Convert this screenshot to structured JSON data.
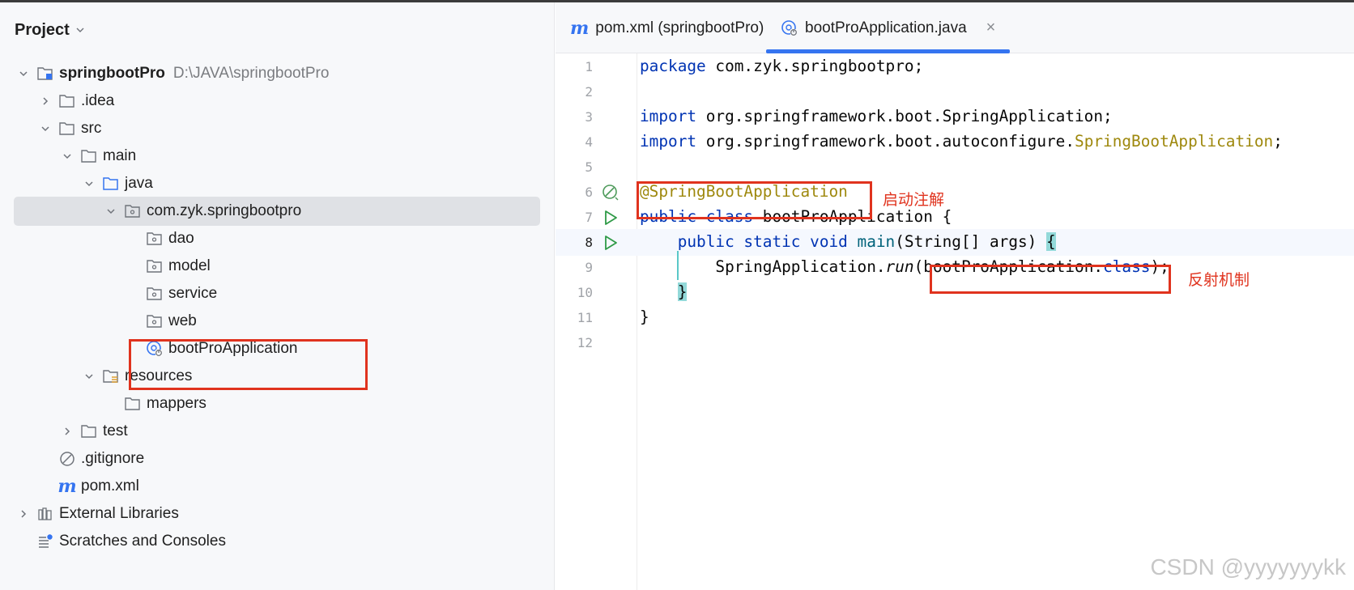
{
  "panel": {
    "title": "Project",
    "tree": [
      {
        "label": "springbootPro",
        "path": "D:\\JAVA\\springbootPro",
        "icon": "module-folder-icon",
        "expand": "down"
      },
      {
        "label": ".idea",
        "icon": "folder-icon",
        "expand": "right"
      },
      {
        "label": "src",
        "icon": "folder-icon",
        "expand": "down"
      },
      {
        "label": "main",
        "icon": "folder-icon",
        "expand": "down"
      },
      {
        "label": "java",
        "icon": "source-folder-icon",
        "expand": "down"
      },
      {
        "label": "com.zyk.springbootpro",
        "icon": "package-icon",
        "expand": "down",
        "selected": true
      },
      {
        "label": "dao",
        "icon": "package-icon"
      },
      {
        "label": "model",
        "icon": "package-icon"
      },
      {
        "label": "service",
        "icon": "package-icon"
      },
      {
        "label": "web",
        "icon": "package-icon"
      },
      {
        "label": "bootProApplication",
        "icon": "spring-boot-class-icon"
      },
      {
        "label": "resources",
        "icon": "resources-folder-icon",
        "expand": "down"
      },
      {
        "label": "mappers",
        "icon": "folder-icon"
      },
      {
        "label": "test",
        "icon": "folder-icon",
        "expand": "right"
      },
      {
        "label": ".gitignore",
        "icon": "gitignore-icon"
      },
      {
        "label": "pom.xml",
        "icon": "maven-icon"
      },
      {
        "label": "External Libraries",
        "icon": "library-icon",
        "expand": "right"
      },
      {
        "label": "Scratches and Consoles",
        "icon": "scratches-icon"
      }
    ]
  },
  "tabs": [
    {
      "label": "pom.xml (springbootPro)",
      "icon": "maven-icon",
      "active": false
    },
    {
      "label": "bootProApplication.java",
      "icon": "spring-boot-class-icon",
      "active": true,
      "close": "×"
    }
  ],
  "editor": {
    "line_numbers": [
      "1",
      "2",
      "3",
      "4",
      "5",
      "6",
      "7",
      "8",
      "9",
      "10",
      "11",
      "12"
    ],
    "current_line": 8,
    "lines": {
      "l1": {
        "kw": "package",
        "rest": " com.zyk.springbootpro;"
      },
      "l3": {
        "kw": "import",
        "rest": " org.springframework.boot.SpringApplication;"
      },
      "l4": {
        "kw": "import",
        "rest": " org.springframework.boot.autoconfigure.",
        "ann": "SpringBootApplication",
        "end": ";"
      },
      "l6": {
        "ann": "@SpringBootApplication"
      },
      "l7": {
        "kw": "public class",
        "rest": " bootProApplication {"
      },
      "l8": {
        "indent": "    ",
        "kw": "public static void",
        "sp": " ",
        "fn": "main",
        "rest": "(String[] args) ",
        "brace": "{"
      },
      "l9": {
        "indent": "        ",
        "pre": "SpringApplication.",
        "it": "run",
        "open": "(",
        "arg": "bootProApplication.",
        "kw": "class",
        "end": ");"
      },
      "l10": {
        "indent": "    ",
        "brace": "}"
      },
      "l11": {
        "text": "}"
      }
    },
    "gutter_icons": {
      "l6": "spring-bean-icon",
      "l7": "run-icon",
      "l8": "run-icon"
    }
  },
  "annotations": {
    "startup_annotation": "启动注解",
    "reflection": "反射机制"
  },
  "watermark": "CSDN @yyyyyyykk",
  "colors": {
    "highlight_box": "#e0331e",
    "keyword": "#0033b3",
    "annotation": "#9e880d",
    "accent": "#3574f0"
  }
}
